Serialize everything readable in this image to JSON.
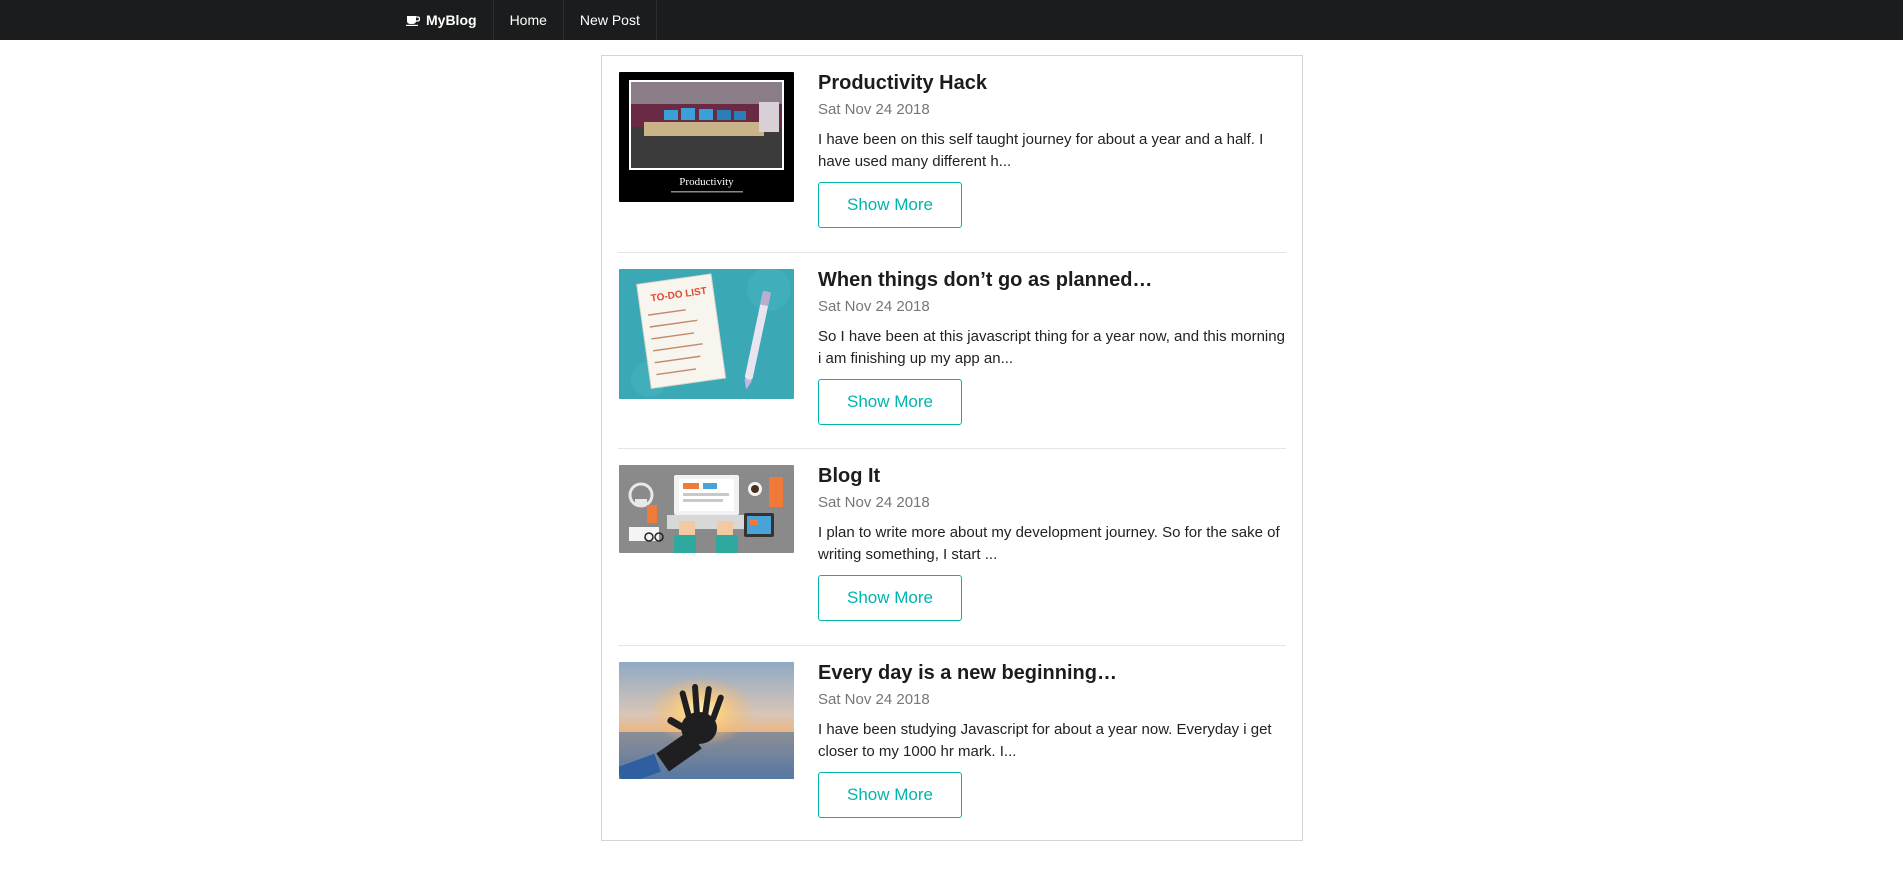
{
  "nav": {
    "brand": "MyBlog",
    "brand_icon": "coffee-cup-icon",
    "home": "Home",
    "new_post": "New Post"
  },
  "posts": [
    {
      "title": "Productivity Hack",
      "date": "Sat Nov 24 2018",
      "excerpt": "I have been on this self taught journey for about a year and a half. I have used many different h...",
      "button": "Show More",
      "thumb_caption": "Productivity"
    },
    {
      "title": "When things don’t go as planned…",
      "date": "Sat Nov 24 2018",
      "excerpt": "So I have been at this javascript thing for a year now, and this morning i am finishing up my app an...",
      "button": "Show More",
      "thumb_caption": "TO-DO LIST"
    },
    {
      "title": "Blog It",
      "date": "Sat Nov 24 2018",
      "excerpt": "I plan to write more about my development journey. So for the sake of writing something, I start ...",
      "button": "Show More"
    },
    {
      "title": "Every day is a new beginning…",
      "date": "Sat Nov 24 2018",
      "excerpt": "I have been studying Javascript for about a year now. Everyday i get closer to my 1000 hr mark. I...",
      "button": "Show More"
    }
  ],
  "colors": {
    "navbar": "#1b1c1d",
    "accent": "#00b5ad",
    "date": "#767676"
  }
}
